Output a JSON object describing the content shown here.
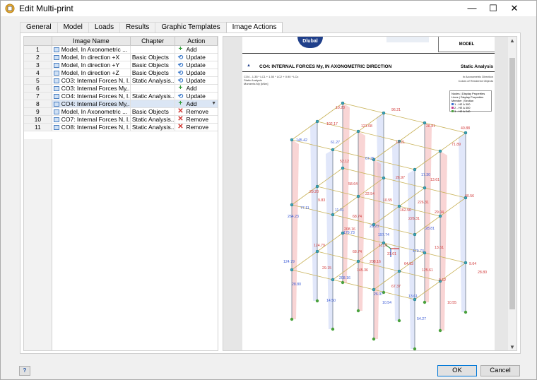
{
  "window": {
    "title": "Edit Multi-print",
    "minimize_glyph": "—",
    "maximize_glyph": "☐",
    "close_glyph": "✕"
  },
  "tabs": [
    {
      "label": "General",
      "active": false
    },
    {
      "label": "Model",
      "active": false
    },
    {
      "label": "Loads",
      "active": false
    },
    {
      "label": "Results",
      "active": false
    },
    {
      "label": "Graphic Templates",
      "active": false
    },
    {
      "label": "Image Actions",
      "active": true
    }
  ],
  "grid": {
    "headers": {
      "image_name": "Image Name",
      "chapter": "Chapter",
      "action": "Action"
    },
    "rows": [
      {
        "num": "1",
        "name": "Model, In Axonometric ...",
        "chapter": "",
        "action": "Add",
        "action_icon": "add-icon",
        "selected": false
      },
      {
        "num": "2",
        "name": "Model, In direction +X",
        "chapter": "Basic Objects",
        "action": "Update",
        "action_icon": "update-icon",
        "selected": false
      },
      {
        "num": "3",
        "name": "Model, In direction +Y",
        "chapter": "Basic Objects",
        "action": "Update",
        "action_icon": "update-icon",
        "selected": false
      },
      {
        "num": "4",
        "name": "Model, In direction +Z",
        "chapter": "Basic Objects",
        "action": "Update",
        "action_icon": "update-icon",
        "selected": false
      },
      {
        "num": "5",
        "name": "CO3: Internal Forces N, I...",
        "chapter": "Static Analysis...",
        "action": "Update",
        "action_icon": "update-icon",
        "selected": false
      },
      {
        "num": "6",
        "name": "CO3: Internal Forces My,...",
        "chapter": "",
        "action": "Add",
        "action_icon": "add-icon",
        "selected": false
      },
      {
        "num": "7",
        "name": "CO4: Internal Forces N, I...",
        "chapter": "Static Analysis...",
        "action": "Update",
        "action_icon": "update-icon",
        "selected": false
      },
      {
        "num": "8",
        "name": "CO4: Internal Forces My,...",
        "chapter": "",
        "action": "Add",
        "action_icon": "add-icon",
        "selected": true
      },
      {
        "num": "9",
        "name": "Model, In Axonometric ...",
        "chapter": "Basic Objects",
        "action": "Remove",
        "action_icon": "remove-icon",
        "selected": false
      },
      {
        "num": "10",
        "name": "CO7: Internal Forces N, I...",
        "chapter": "Static Analysis...",
        "action": "Remove",
        "action_icon": "remove-icon",
        "selected": false
      },
      {
        "num": "11",
        "name": "CO8: Internal Forces N, I...",
        "chapter": "Static Analysis...",
        "action": "Remove",
        "action_icon": "remove-icon",
        "selected": false
      }
    ]
  },
  "preview": {
    "logo": "Dlubal",
    "model_label": "MODEL",
    "heading": "CO4: INTERNAL FORCES My, IN AXONOMETRIC DIRECTION",
    "heading_right": "Static Analysis",
    "info_lines": [
      "CO4 - 1.35 * LC1 + 1.50 * LC2 + 0.90 * LCx",
      "Static Analysis",
      "Moments My [kNm]"
    ],
    "info_right": [
      "In Axonometric Direction",
      "Colors of Rendered Objects"
    ],
    "legend_lines": [
      "Nodes | Display Properties",
      "Lines | Display Properties",
      "Member | Section",
      "1 - HE A 300",
      "2 - HE A 300",
      "3 - HE A 240"
    ],
    "legend_colors": [
      "#3b6fd1",
      "#c23b8f",
      "#4aa13d"
    ],
    "value_labels": [
      "124.79",
      "124.79",
      "208.16",
      "208.16",
      "208.16",
      "11.01",
      "26.97",
      "64.93",
      "13.61",
      "13.61",
      "9.12",
      "9.64",
      "77.11",
      "29.20",
      "52.12",
      "11.01",
      "22.54",
      "26.97",
      "29.20",
      "162.56",
      "13.61",
      "28.81",
      "29.04",
      "40.56",
      "145.42",
      "102.17",
      "10.20",
      "61.27",
      "121.08",
      "96.21",
      "67.25",
      "10.21",
      "28.81",
      "17.30",
      "71.89",
      "40.88",
      "28.80",
      "29.15",
      "68.74",
      "14.50",
      "145.36",
      "31.01",
      "10.54",
      "67.37",
      "125.61",
      "54.27",
      "10.55",
      "28.80",
      "264.23",
      "9.83",
      "58.64",
      "179.73",
      "68.74",
      "10.55",
      "197.74",
      "226.31",
      "226.31",
      "179.73"
    ]
  },
  "footer": {
    "ok": "OK",
    "cancel": "Cancel",
    "help_glyph": "?"
  },
  "colors": {
    "selection": "#dbe6f5",
    "add": "#2e9a35",
    "update": "#3a78c9",
    "remove": "#d0302a",
    "dlubal_blue": "#1f3f8a"
  }
}
